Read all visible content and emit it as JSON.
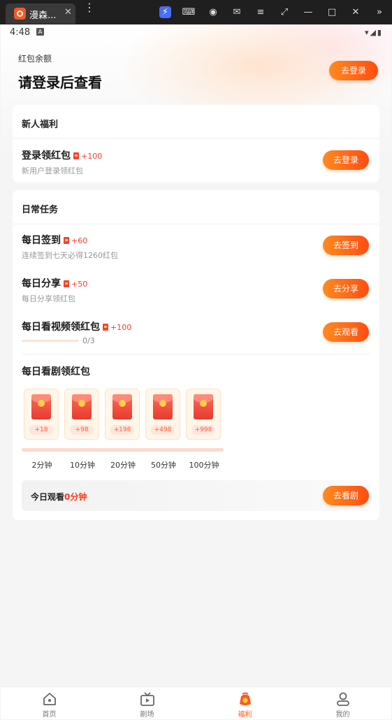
{
  "window": {
    "tab_title": "漫森...",
    "tab_close": "✕",
    "menu": "⋮",
    "buttons": [
      "⚡",
      "⌨",
      "◉",
      "✉",
      "≡",
      "⤢",
      "—",
      "□",
      "✕",
      "»"
    ]
  },
  "statusbar": {
    "time": "4:48",
    "notif": "A",
    "icons": "▾◢▮"
  },
  "hero": {
    "balance_label": "红包余额",
    "balance_value": "请登录后查看",
    "login_button": "去登录"
  },
  "newbie": {
    "header": "新人福利",
    "task": {
      "title": "登录领红包",
      "reward": "+100",
      "sub": "新用户登录领红包",
      "button": "去登录"
    }
  },
  "daily": {
    "header": "日常任务",
    "tasks": [
      {
        "title": "每日签到",
        "reward": "+60",
        "sub": "连续签到七天必得1260红包",
        "button": "去签到"
      },
      {
        "title": "每日分享",
        "reward": "+50",
        "sub": "每日分享领红包",
        "button": "去分享"
      },
      {
        "title": "每日看视频领红包",
        "reward": "+100",
        "progress_text": "0/3",
        "progress": 0,
        "button": "去观看"
      }
    ],
    "watch": {
      "title": "每日看剧领红包",
      "packets": [
        {
          "amount": "+18",
          "time": "2分钟"
        },
        {
          "amount": "+98",
          "time": "10分钟"
        },
        {
          "amount": "+198",
          "time": "20分钟"
        },
        {
          "amount": "+498",
          "time": "50分钟"
        },
        {
          "amount": "+998",
          "time": "100分钟"
        }
      ],
      "today_label": "今日观看",
      "today_value": "0分钟",
      "button": "去看剧"
    }
  },
  "nav": {
    "items": [
      {
        "label": "首页",
        "icon": "home-icon"
      },
      {
        "label": "剧场",
        "icon": "tv-icon"
      },
      {
        "label": "福利",
        "icon": "red-packet-icon",
        "active": true
      },
      {
        "label": "我的",
        "icon": "user-icon"
      }
    ]
  },
  "colors": {
    "accent": "#ff5a1f",
    "reward": "#ff3b30"
  }
}
